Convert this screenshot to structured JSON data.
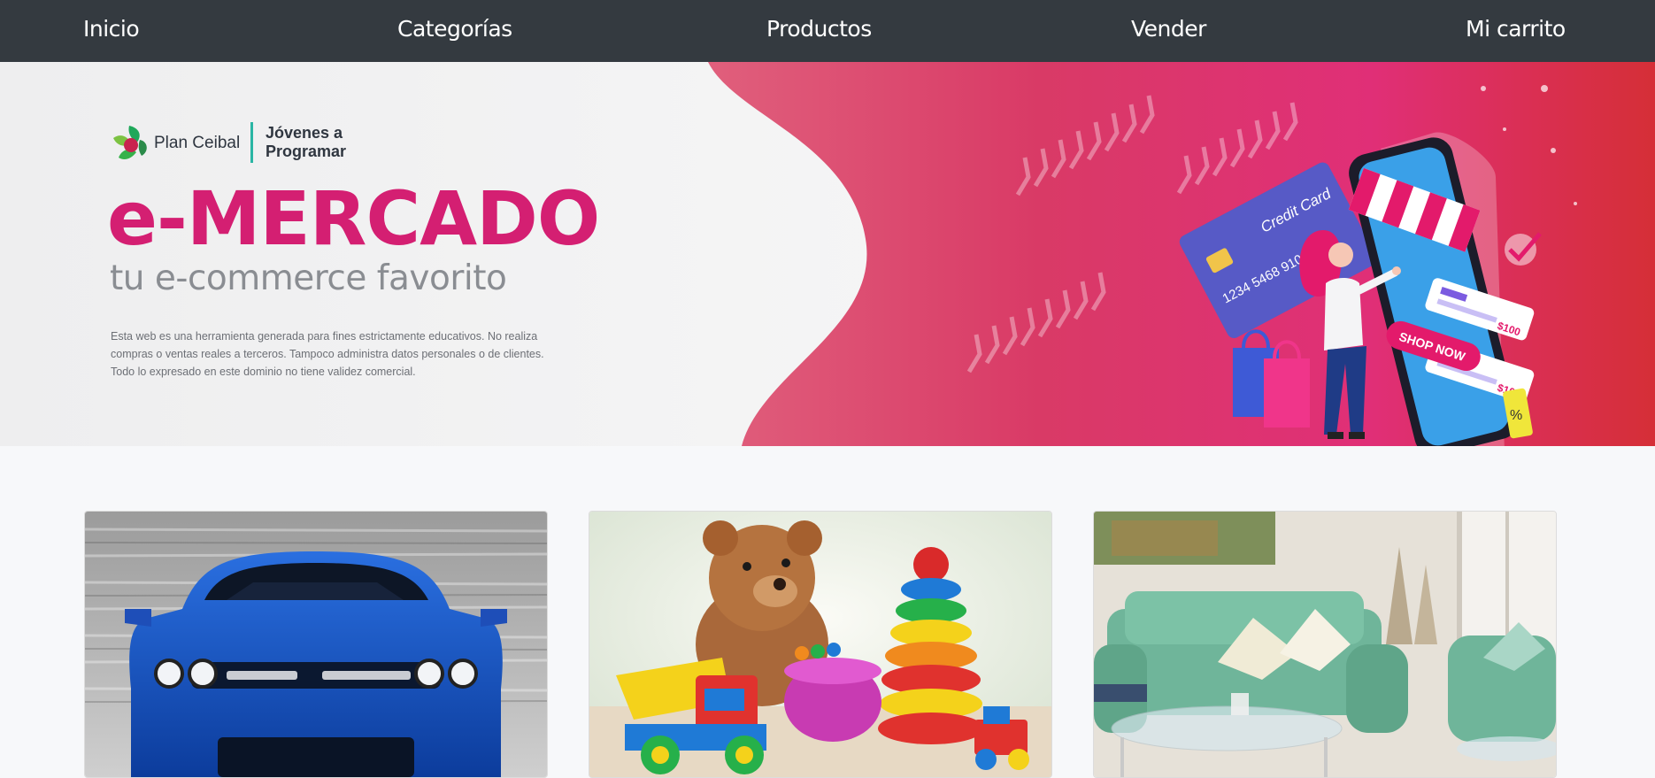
{
  "nav": {
    "items": [
      {
        "label": "Inicio"
      },
      {
        "label": "Categorías"
      },
      {
        "label": "Productos"
      },
      {
        "label": "Vender"
      },
      {
        "label": "Mi carrito"
      }
    ]
  },
  "hero": {
    "logo_name": "Plan Ceibal",
    "logo_sub": "Jóvenes a Programar",
    "title": "e-MERCADO",
    "subtitle": "tu e-commerce favorito",
    "disclaimer": "Esta web es una herramienta generada para fines estrictamente educativos. No realiza compras o ventas reales a terceros. Tampoco administra datos personales o de clientes. Todo lo expresado en este dominio no tiene validez comercial.",
    "card_title": "Credit Card",
    "card_number": "1234 5468 9101 1213",
    "shop_now": "SHOP NOW",
    "price_1": "$100",
    "price_2": "$100",
    "tag": "%"
  },
  "colors": {
    "nav_bg": "#343a40",
    "brand_pink": "#d41f72",
    "hero_red": "#d7303e",
    "page_bg": "#f7f8fa"
  },
  "categories": [
    {
      "image": "blue sports car"
    },
    {
      "image": "toys: teddy bear, stacking rings, toy truck"
    },
    {
      "image": "living room: green sofa and armchair"
    }
  ]
}
